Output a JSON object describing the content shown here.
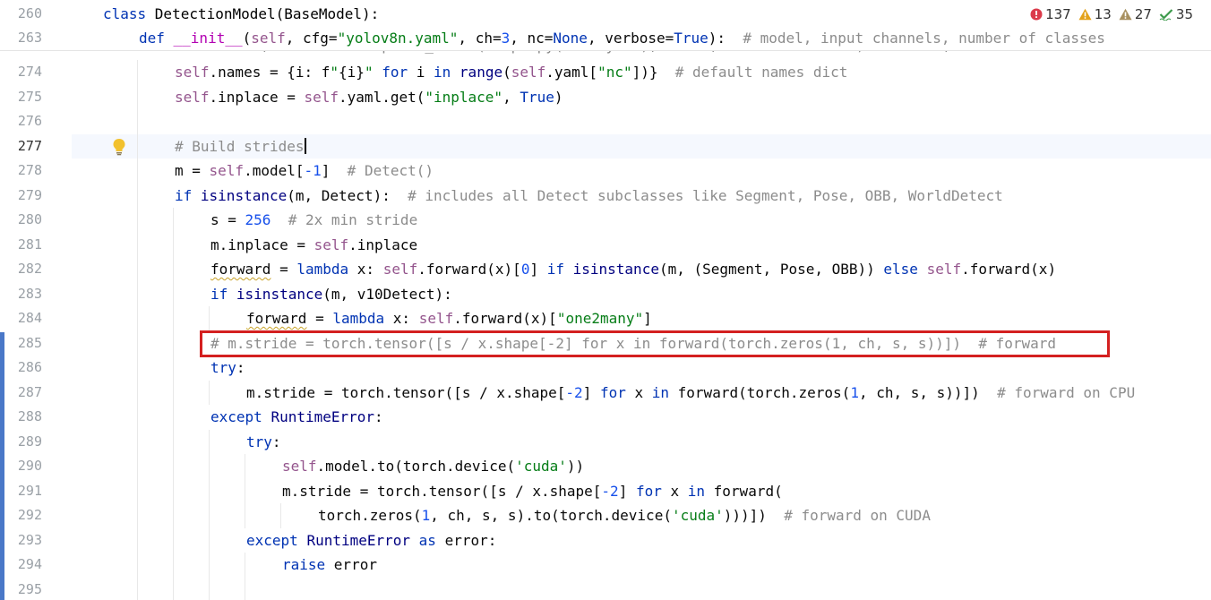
{
  "inspections": {
    "errors": "137",
    "warnings": "13",
    "weak_warnings": "27",
    "typos": "35"
  },
  "sticky_lines": [
    {
      "num": "260",
      "indent": 0,
      "tokens": [
        [
          "kw",
          "class "
        ],
        [
          "cls",
          "DetectionModel(BaseModel):"
        ]
      ]
    },
    {
      "num": "263",
      "indent": 1,
      "tokens": [
        [
          "kw",
          "def "
        ],
        [
          "dunder",
          "__init__"
        ],
        [
          "",
          "("
        ],
        [
          "self",
          "self"
        ],
        [
          "",
          ", cfg="
        ],
        [
          "str",
          "\"yolov8n.yaml\""
        ],
        [
          "",
          ", ch="
        ],
        [
          "num",
          "3"
        ],
        [
          "",
          ", nc="
        ],
        [
          "kw",
          "None"
        ],
        [
          "",
          ", verbose="
        ],
        [
          "kw",
          "True"
        ],
        [
          "",
          "):  "
        ],
        [
          "cm",
          "# model, input channels, number of classes"
        ]
      ]
    }
  ],
  "peek_line": {
    "text": "self.model, self.save = parse_model(deepcopy(self.yaml), ch=ch, verbose=verbose)  # model, savelist"
  },
  "lines": [
    {
      "num": "274",
      "indent": 2,
      "tokens": [
        [
          "self",
          "self"
        ],
        [
          "",
          ".names = {i: f"
        ],
        [
          "str",
          "\""
        ],
        [
          "",
          "{i}"
        ],
        [
          "str",
          "\""
        ],
        [
          "kw",
          " for "
        ],
        [
          "",
          "i "
        ],
        [
          "kw",
          "in "
        ],
        [
          "bi",
          "range"
        ],
        [
          "",
          "("
        ],
        [
          "self",
          "self"
        ],
        [
          "",
          ".yaml["
        ],
        [
          "str",
          "\"nc\""
        ],
        [
          "",
          "])}  "
        ],
        [
          "cm",
          "# default names dict"
        ]
      ]
    },
    {
      "num": "275",
      "indent": 2,
      "tokens": [
        [
          "self",
          "self"
        ],
        [
          "",
          ".inplace = "
        ],
        [
          "self",
          "self"
        ],
        [
          "",
          ".yaml.get("
        ],
        [
          "str",
          "\"inplace\""
        ],
        [
          "",
          ", "
        ],
        [
          "kw",
          "True"
        ],
        [
          "",
          ")"
        ]
      ]
    },
    {
      "num": "276",
      "indent": 2,
      "tokens": []
    },
    {
      "num": "277",
      "indent": 2,
      "current": true,
      "tokens": [
        [
          "cm",
          "# Build strides"
        ]
      ]
    },
    {
      "num": "278",
      "indent": 2,
      "tokens": [
        [
          "",
          "m = "
        ],
        [
          "self",
          "self"
        ],
        [
          "",
          ".model["
        ],
        [
          "num",
          "-1"
        ],
        [
          "",
          "]  "
        ],
        [
          "cm",
          "# Detect()"
        ]
      ]
    },
    {
      "num": "279",
      "indent": 2,
      "tokens": [
        [
          "kw",
          "if "
        ],
        [
          "bi",
          "isinstance"
        ],
        [
          "",
          "(m, Detect):  "
        ],
        [
          "cm",
          "# includes all Detect subclasses like Segment, Pose, OBB, WorldDetect"
        ]
      ]
    },
    {
      "num": "280",
      "indent": 3,
      "tokens": [
        [
          "",
          "s = "
        ],
        [
          "num",
          "256"
        ],
        [
          "",
          "  "
        ],
        [
          "cm",
          "# 2x min stride"
        ]
      ]
    },
    {
      "num": "281",
      "indent": 3,
      "tokens": [
        [
          "",
          "m.inplace = "
        ],
        [
          "self",
          "self"
        ],
        [
          "",
          ".inplace"
        ]
      ]
    },
    {
      "num": "282",
      "indent": 3,
      "tokens": [
        [
          "squig",
          "forward"
        ],
        [
          "",
          " = "
        ],
        [
          "kw",
          "lambda "
        ],
        [
          "",
          "x: "
        ],
        [
          "self",
          "self"
        ],
        [
          "",
          ".forward(x)["
        ],
        [
          "num",
          "0"
        ],
        [
          "",
          "] "
        ],
        [
          "kw",
          "if "
        ],
        [
          "bi",
          "isinstance"
        ],
        [
          "",
          "(m, (Segment, Pose, OBB)) "
        ],
        [
          "kw",
          "else "
        ],
        [
          "self",
          "self"
        ],
        [
          "",
          ".forward(x)"
        ]
      ]
    },
    {
      "num": "283",
      "indent": 3,
      "tokens": [
        [
          "kw",
          "if "
        ],
        [
          "bi",
          "isinstance"
        ],
        [
          "",
          "(m, v10Detect):"
        ]
      ]
    },
    {
      "num": "284",
      "indent": 4,
      "tokens": [
        [
          "squig",
          "forward"
        ],
        [
          "",
          " = "
        ],
        [
          "kw",
          "lambda "
        ],
        [
          "",
          "x: "
        ],
        [
          "self",
          "self"
        ],
        [
          "",
          ".forward(x)["
        ],
        [
          "str",
          "\"one2many\""
        ],
        [
          "",
          "]"
        ]
      ]
    },
    {
      "num": "285",
      "indent": 3,
      "tokens": [
        [
          "cm",
          "# m.stride = torch.tensor([s / x.shape[-2] for x in forward(torch.zeros(1, ch, s, s))])  # forward"
        ]
      ]
    },
    {
      "num": "286",
      "indent": 3,
      "tokens": [
        [
          "kw",
          "try"
        ],
        [
          "",
          ":"
        ]
      ]
    },
    {
      "num": "287",
      "indent": 4,
      "tokens": [
        [
          "",
          "m.stride = torch.tensor([s / x.shape["
        ],
        [
          "num",
          "-2"
        ],
        [
          "",
          "] "
        ],
        [
          "kw",
          "for "
        ],
        [
          "",
          "x "
        ],
        [
          "kw",
          "in "
        ],
        [
          "",
          "forward(torch.zeros("
        ],
        [
          "num",
          "1"
        ],
        [
          "",
          ", ch, s, s))])  "
        ],
        [
          "cm",
          "# forward on CPU"
        ]
      ]
    },
    {
      "num": "288",
      "indent": 3,
      "tokens": [
        [
          "kw",
          "except "
        ],
        [
          "bi",
          "RuntimeError"
        ],
        [
          "",
          ":"
        ]
      ]
    },
    {
      "num": "289",
      "indent": 4,
      "tokens": [
        [
          "kw",
          "try"
        ],
        [
          "",
          ":"
        ]
      ]
    },
    {
      "num": "290",
      "indent": 5,
      "tokens": [
        [
          "self",
          "self"
        ],
        [
          "",
          ".model.to(torch.device("
        ],
        [
          "str",
          "'cuda'"
        ],
        [
          "",
          "))"
        ]
      ]
    },
    {
      "num": "291",
      "indent": 5,
      "tokens": [
        [
          "",
          "m.stride = torch.tensor([s / x.shape["
        ],
        [
          "num",
          "-2"
        ],
        [
          "",
          "] "
        ],
        [
          "kw",
          "for "
        ],
        [
          "",
          "x "
        ],
        [
          "kw",
          "in "
        ],
        [
          "",
          "forward("
        ]
      ]
    },
    {
      "num": "292",
      "indent": 6,
      "tokens": [
        [
          "",
          "torch.zeros("
        ],
        [
          "num",
          "1"
        ],
        [
          "",
          ", ch, s, s).to(torch.device("
        ],
        [
          "str",
          "'cuda'"
        ],
        [
          "",
          ")))])  "
        ],
        [
          "cm",
          "# forward on CUDA"
        ]
      ]
    },
    {
      "num": "293",
      "indent": 4,
      "tokens": [
        [
          "kw",
          "except "
        ],
        [
          "bi",
          "RuntimeError "
        ],
        [
          "kw",
          "as "
        ],
        [
          "",
          "error:"
        ]
      ]
    },
    {
      "num": "294",
      "indent": 5,
      "tokens": [
        [
          "kw",
          "raise "
        ],
        [
          "",
          "error"
        ]
      ]
    },
    {
      "num": "295",
      "indent": 5,
      "tokens": []
    }
  ],
  "colors": {
    "keyword": "#0033b3",
    "self": "#94558d",
    "string": "#067d17",
    "number": "#1750eb",
    "comment": "#8c8c8c",
    "highlight_box": "#d42020",
    "change_bar": "#4a78c8"
  },
  "icons": {
    "error": "error-icon",
    "warning": "warning-icon",
    "weak_warning": "weak-warning-icon",
    "typo": "typo-check-icon",
    "intention": "lightbulb-icon"
  }
}
